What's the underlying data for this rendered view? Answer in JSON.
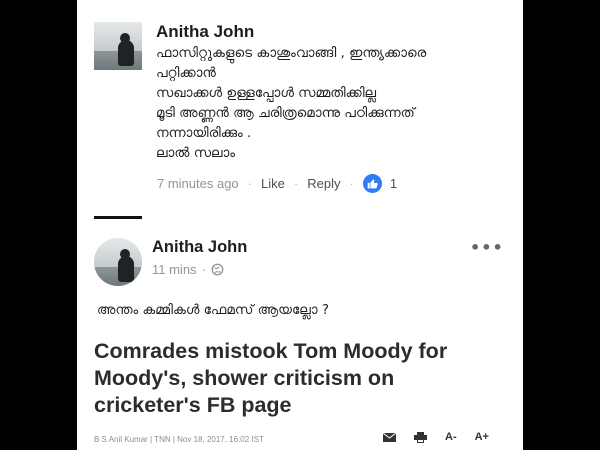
{
  "comment": {
    "author": "Anitha John",
    "lines": [
      "ഫാസിറ്റുകളുടെ കാശുംവാങ്ങി , ഇന്ത്യക്കാരെ",
      "പറ്റിക്കാൻ",
      "സഖാക്കൾ ഉള്ളപ്പോൾ സമ്മതിക്കില്ല",
      "മൂടി അണ്ണൻ ആ ചരിത്രമൊന്നു പഠിക്കുന്നത്",
      "നന്നായിരിക്കും .",
      "ലാൽ സലാം"
    ],
    "time": "7 minutes ago",
    "like_label": "Like",
    "reply_label": "Reply",
    "like_count": "1",
    "like_color": "#2f7cf6"
  },
  "post": {
    "author": "Anitha John",
    "time": "11 mins",
    "audience_icon": "globe-icon",
    "more_icon": "more-options-icon",
    "more_label": "•••",
    "text": "അന്തം കമ്മികൾ ഫേമസ് ആയല്ലോ ?",
    "headline_lines": [
      "Comrades mistook Tom Moody for",
      "Moody's, shower criticism on",
      "cricketer's FB page"
    ],
    "byline": "B S Anil Kumar | TNN | Nov 18, 2017, 16:02 IST",
    "tools": {
      "email_icon": "email-icon",
      "print_icon": "print-icon",
      "font_decrease": "A-",
      "font_increase": "A+"
    }
  }
}
